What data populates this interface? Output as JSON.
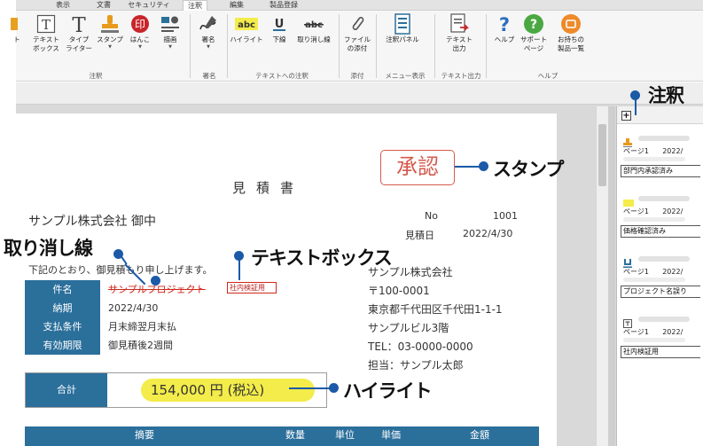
{
  "ribbon": {
    "tabs": [
      "表示",
      "文書",
      "セキュリティ",
      "注釈",
      "編集",
      "製品登録"
    ],
    "active_tab": "注釈",
    "buttons": [
      {
        "label": "ト",
        "icon": "partial-tool-icon"
      },
      {
        "label": "テキスト\nボックス",
        "icon": "text-box-icon"
      },
      {
        "label": "タイプ\nライター",
        "icon": "typewriter-icon"
      },
      {
        "label": "スタンプ",
        "icon": "stamp-icon"
      },
      {
        "label": "はんこ",
        "icon": "hanko-icon"
      },
      {
        "label": "描画",
        "icon": "drawing-icon"
      },
      {
        "label": "署名",
        "icon": "signature-icon"
      },
      {
        "label": "ハイライト",
        "icon": "highlight-icon"
      },
      {
        "label": "下線",
        "icon": "underline-icon"
      },
      {
        "label": "取り消し線",
        "icon": "strikethrough-icon"
      },
      {
        "label": "ファイル\nの添付",
        "icon": "attach-icon"
      },
      {
        "label": "注釈パネル",
        "icon": "annotation-panel-icon"
      },
      {
        "label": "テキスト\n出力",
        "icon": "text-export-icon"
      },
      {
        "label": "ヘルプ",
        "icon": "help-icon"
      },
      {
        "label": "サポート\nページ",
        "icon": "support-icon"
      },
      {
        "label": "お持ちの\n製品一覧",
        "icon": "products-icon"
      }
    ],
    "groups": [
      "注釈",
      "署名",
      "テキストへの注釈",
      "添付",
      "メニュー表示",
      "テキスト出力",
      "ヘルプ"
    ],
    "icon_glyphs": {
      "text_box": "T",
      "typewriter": "T",
      "hanko": "印",
      "highlight": "abc",
      "underline": "U",
      "strikethrough": "abc",
      "help": "?",
      "support": "?"
    }
  },
  "document": {
    "title": "見積書",
    "customer": "サンプル株式会社 御中",
    "no_label": "No",
    "no_value": "1001",
    "date_label": "見積日",
    "date_value": "2022/4/30",
    "intro": "下記のとおり、御見積もり申し上げます。",
    "stamp_text": "承認",
    "info_rows": [
      {
        "label": "件名",
        "value": "サンプルプロジェクト"
      },
      {
        "label": "納期",
        "value": "2022/4/30"
      },
      {
        "label": "支払条件",
        "value": "月末締翌月末払"
      },
      {
        "label": "有効期限",
        "value": "御見積後2週間"
      }
    ],
    "textbox_note": "社内検証用",
    "vendor": [
      "サンプル株式会社",
      "〒100-0001",
      "東京都千代田区千代田1-1-1",
      "サンプルビル3階",
      "TEL：03-0000-0000",
      "担当：サンプル太郎"
    ],
    "total_label": "合計",
    "total_value": "154,000 円 (税込)",
    "items_headers": [
      "摘要",
      "数量",
      "単位",
      "単価",
      "金額"
    ]
  },
  "panel": {
    "annotations": [
      {
        "page": "ページ1",
        "date": "2022/",
        "note": "部門内承認済み",
        "icon": "stamp-icon"
      },
      {
        "page": "ページ1",
        "date": "2022/",
        "note": "価格確認済み",
        "icon": "highlight-icon"
      },
      {
        "page": "ページ1",
        "date": "2022/",
        "note": "プロジェクト名誤り",
        "icon": "underline-icon"
      },
      {
        "page": "ページ1",
        "date": "2022/",
        "note": "社内検証用",
        "icon": "text-box-icon"
      }
    ]
  },
  "callouts": {
    "annotation": "注釈",
    "stamp": "スタンプ",
    "strikethrough": "取り消し線",
    "textbox": "テキストボックス",
    "highlight": "ハイライト"
  },
  "colors": {
    "accent_blue": "#2b6f9b",
    "stamp_red": "#d65a4d",
    "highlight_yellow": "#f3ec4a",
    "callout_blue": "#1c5aa8"
  }
}
